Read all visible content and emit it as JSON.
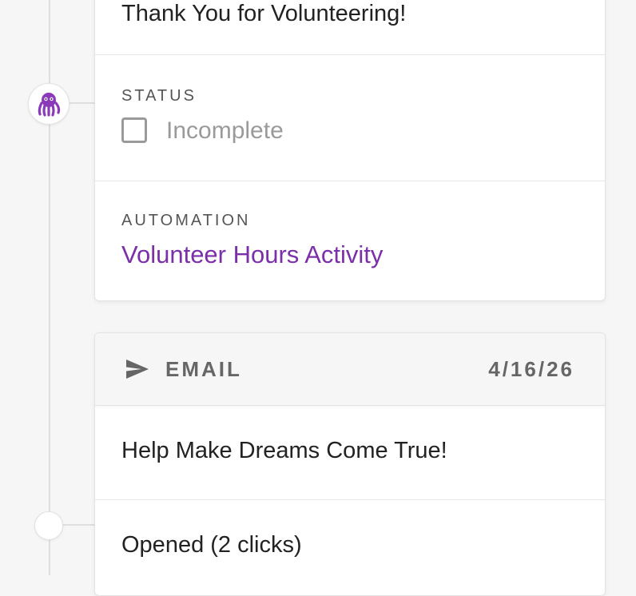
{
  "activity_card": {
    "subject": "Thank You for Volunteering!",
    "status_label": "STATUS",
    "status_value": "Incomplete",
    "automation_label": "AUTOMATION",
    "automation_link": "Volunteer Hours Activity"
  },
  "email_card": {
    "type_label": "EMAIL",
    "date": "4/16/26",
    "subject": "Help Make Dreams Come True!",
    "engagement": "Opened (2 clicks)"
  },
  "colors": {
    "accent": "#7b2fa8",
    "avatar_octopus": "#8a3ab9",
    "muted": "#9a9a9a"
  },
  "icons": {
    "avatar": "octopus-icon",
    "email": "send-icon"
  }
}
